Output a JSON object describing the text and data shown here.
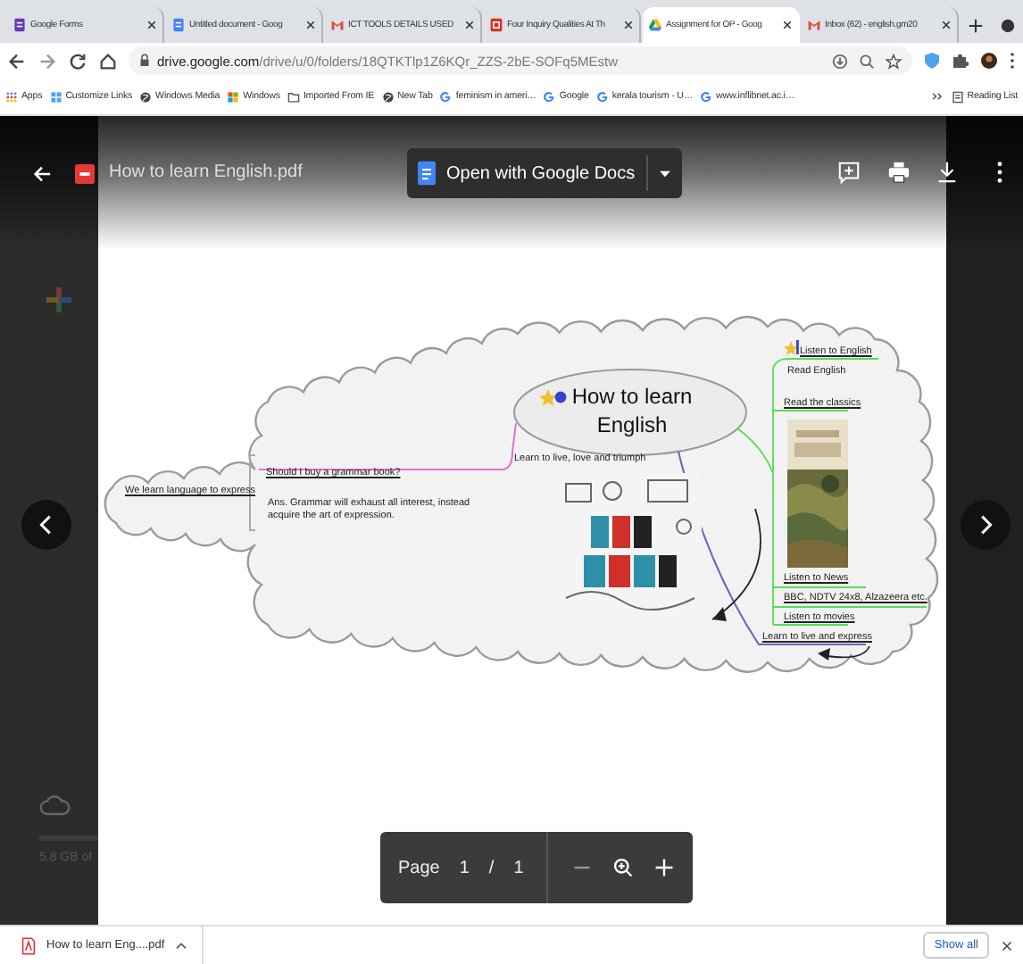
{
  "tabs": [
    {
      "title": "Google Forms",
      "selected": false
    },
    {
      "title": "Untitled document - Goog",
      "selected": false
    },
    {
      "title": "ICT TOOLS DETAILS USED",
      "selected": false
    },
    {
      "title": "Four Inquiry Qualities At Th",
      "selected": false
    },
    {
      "title": "Assignment for OP - Goog",
      "selected": true
    },
    {
      "title": "Inbox (62) - english.gm20",
      "selected": false
    }
  ],
  "address": {
    "host": "drive.google.com",
    "path": "/drive/u/0/folders/18QTKTlp1Z6KQr_ZZS-2bE-SOFq5MEstw"
  },
  "bookmarks": [
    {
      "label": "Apps"
    },
    {
      "label": "Customize Links"
    },
    {
      "label": "Windows Media"
    },
    {
      "label": "Windows"
    },
    {
      "label": "Imported From IE"
    },
    {
      "label": "New Tab"
    },
    {
      "label": "feminism in ameri…"
    },
    {
      "label": "Google"
    },
    {
      "label": "kerala tourism - U…"
    },
    {
      "label": "www.inflibnet.ac.i…"
    }
  ],
  "reading_list": "Reading List",
  "drive_backdrop": {
    "storage_text": "5.8 GB of"
  },
  "viewer": {
    "file_name": "How to learn English.pdf",
    "open_with": "Open with Google Docs"
  },
  "mindmap": {
    "nodes": [
      {
        "text": "How to learn English",
        "kind": "central"
      },
      {
        "text": "We learn language to express",
        "kind": "label"
      },
      {
        "text": "Should I buy a grammar book?",
        "kind": "label"
      },
      {
        "text": "Ans. Grammar will exhaust all interest, instead acquire the art of expression.",
        "kind": "note"
      },
      {
        "text": "Learn to live, love and triumph",
        "kind": "caption"
      },
      {
        "text": "Listen to English",
        "kind": "label"
      },
      {
        "text": "Read English",
        "kind": "caption"
      },
      {
        "text": "Read the classics",
        "kind": "label"
      },
      {
        "text": "Listen to News",
        "kind": "label"
      },
      {
        "text": "BBC, NDTV 24x8, Alzazeera etc.",
        "kind": "label"
      },
      {
        "text": "Listen to movies",
        "kind": "label"
      },
      {
        "text": "Learn to live and express",
        "kind": "label"
      }
    ]
  },
  "page_controls": {
    "label": "Page",
    "current": "1",
    "separator": "/",
    "total": "1"
  },
  "download": {
    "file": "How to learn Eng....pdf",
    "show_all": "Show all"
  }
}
